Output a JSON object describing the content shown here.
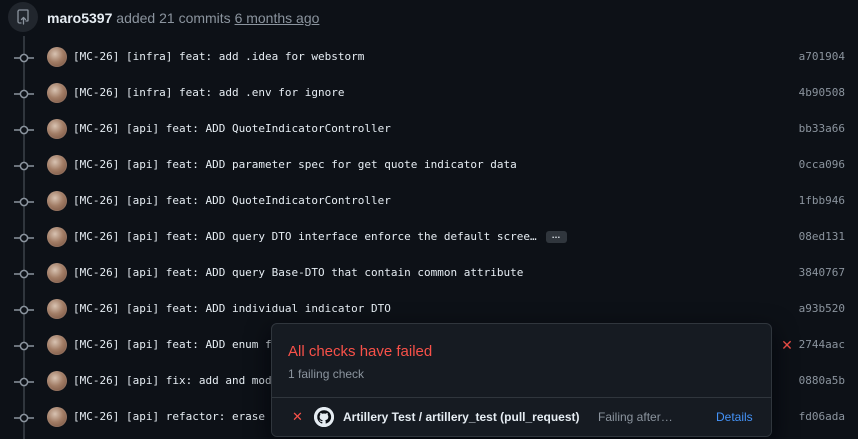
{
  "push_event": {
    "author": "maro5397",
    "action_text": " added 21 commits ",
    "time_ago": "6 months ago",
    "icon": "repo-push-icon"
  },
  "commits": [
    {
      "message": "[MC-26] [infra] feat: add .idea for webstorm",
      "sha": "a701904",
      "has_ellipsis": false,
      "status": ""
    },
    {
      "message": "[MC-26] [infra] feat: add .env for ignore",
      "sha": "4b90508",
      "has_ellipsis": false,
      "status": ""
    },
    {
      "message": "[MC-26] [api] feat: ADD QuoteIndicatorController",
      "sha": "bb33a66",
      "has_ellipsis": false,
      "status": ""
    },
    {
      "message": "[MC-26] [api] feat: ADD parameter spec for get quote indicator data",
      "sha": "0cca096",
      "has_ellipsis": false,
      "status": ""
    },
    {
      "message": "[MC-26] [api] feat: ADD QuoteIndicatorController",
      "sha": "1fbb946",
      "has_ellipsis": false,
      "status": ""
    },
    {
      "message": "[MC-26] [api] feat: ADD query DTO interface enforce the default scree…",
      "sha": "08ed131",
      "has_ellipsis": true,
      "status": ""
    },
    {
      "message": "[MC-26] [api] feat: ADD query Base-DTO that contain common attribute",
      "sha": "3840767",
      "has_ellipsis": false,
      "status": ""
    },
    {
      "message": "[MC-26] [api] feat: ADD individual indicator DTO",
      "sha": "a93b520",
      "has_ellipsis": false,
      "status": ""
    },
    {
      "message": "[MC-26] [api] feat: ADD enum f",
      "sha": "2744aac",
      "has_ellipsis": false,
      "status": "failed"
    },
    {
      "message": "[MC-26] [api] fix: add and mod",
      "sha": "0880a5b",
      "has_ellipsis": false,
      "status": ""
    },
    {
      "message": "[MC-26] [api] refactor: erase",
      "sha": "fd06ada",
      "has_ellipsis": false,
      "status": ""
    }
  ],
  "ellipsis_label": "…",
  "fail_symbol": "✕",
  "checks_popover": {
    "title": "All checks have failed",
    "subtitle": "1 failing check",
    "check": {
      "status_symbol": "✕",
      "name": "Artillery Test / artillery_test (pull_request)",
      "status_text": "Failing after…",
      "details_label": "Details",
      "app_icon": "github-icon"
    }
  },
  "colors": {
    "background": "#0d1117",
    "text_primary": "#e6edf3",
    "text_muted": "#8b949e",
    "danger": "#f85149",
    "link": "#4493f8",
    "border": "#30363d",
    "overlay": "#161b22"
  }
}
